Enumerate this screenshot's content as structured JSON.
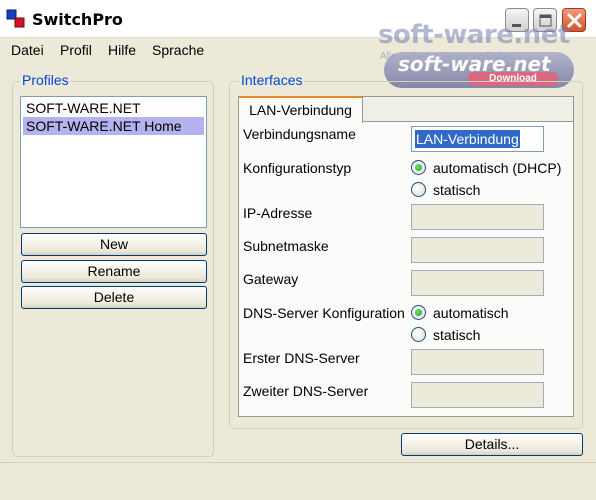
{
  "window": {
    "title": "SwitchPro",
    "icon": "switchpro-app-icon",
    "controls": [
      "minimize-icon",
      "maximize-icon",
      "close-icon"
    ]
  },
  "watermark": {
    "brand": "soft-ware.net",
    "small": "Alle Software immer verfügbar",
    "pill_brand": "soft-ware.net",
    "pill_sub": "Download"
  },
  "menu": [
    "Datei",
    "Profil",
    "Hilfe",
    "Sprache"
  ],
  "profiles": {
    "label": "Profiles",
    "items": [
      "SOFT-WARE.NET",
      "SOFT-WARE.NET Home"
    ],
    "selected_index": 1,
    "buttons": {
      "new": "New",
      "rename": "Rename",
      "delete": "Delete"
    }
  },
  "interfaces": {
    "label": "Interfaces",
    "tab": "LAN-Verbindung",
    "fields": {
      "verbindungsname_label": "Verbindungsname",
      "verbindungsname_value": "LAN-Verbindung",
      "konfigurationstyp_label": "Konfigurationstyp",
      "konfig_option_auto": "automatisch (DHCP)",
      "konfig_option_static": "statisch",
      "konfig_selected": "automatisch (DHCP)",
      "ip_label": "IP-Adresse",
      "subnet_label": "Subnetmaske",
      "gateway_label": "Gateway",
      "dns_config_label": "DNS-Server Konfiguration",
      "dns_option_auto": "automatisch",
      "dns_option_static": "statisch",
      "dns_selected": "automatisch",
      "dns1_label": "Erster DNS-Server",
      "dns2_label": "Zweiter DNS-Server"
    },
    "details_button": "Details..."
  },
  "colors": {
    "group_label": "#0046d5",
    "selection": "#b4b3f0",
    "window_bg": "#ece9d8",
    "radio_checked": "#21a121"
  }
}
